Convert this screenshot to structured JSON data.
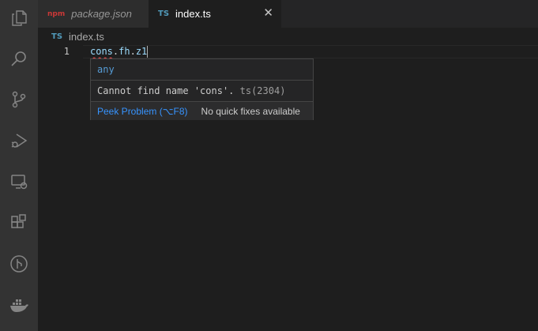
{
  "tabs": [
    {
      "label": "package.json",
      "icon": "json-file-icon"
    },
    {
      "label": "index.ts",
      "icon": "ts-file-icon",
      "close": "✕"
    }
  ],
  "file_icon_text": "TS",
  "json_icon_text": "npm",
  "breadcrumb": {
    "file": "index.ts"
  },
  "editor": {
    "line_number": "1",
    "tokens": {
      "var": "cons",
      "dot1": ".",
      "prop1": "fh",
      "dot2": ".",
      "prop2": "z1"
    }
  },
  "hover": {
    "type": "any",
    "message": "Cannot find name 'cons'.",
    "code": "ts(2304)",
    "peek_label": "Peek Problem (⌥F8)",
    "quick_fix_text": "No quick fixes available"
  },
  "colors": {
    "activity_bar": "#333333",
    "editor_bg": "#1e1e1e",
    "link": "#3794ff",
    "ts_icon": "#519aba",
    "error_squiggle": "#f14c4c"
  }
}
